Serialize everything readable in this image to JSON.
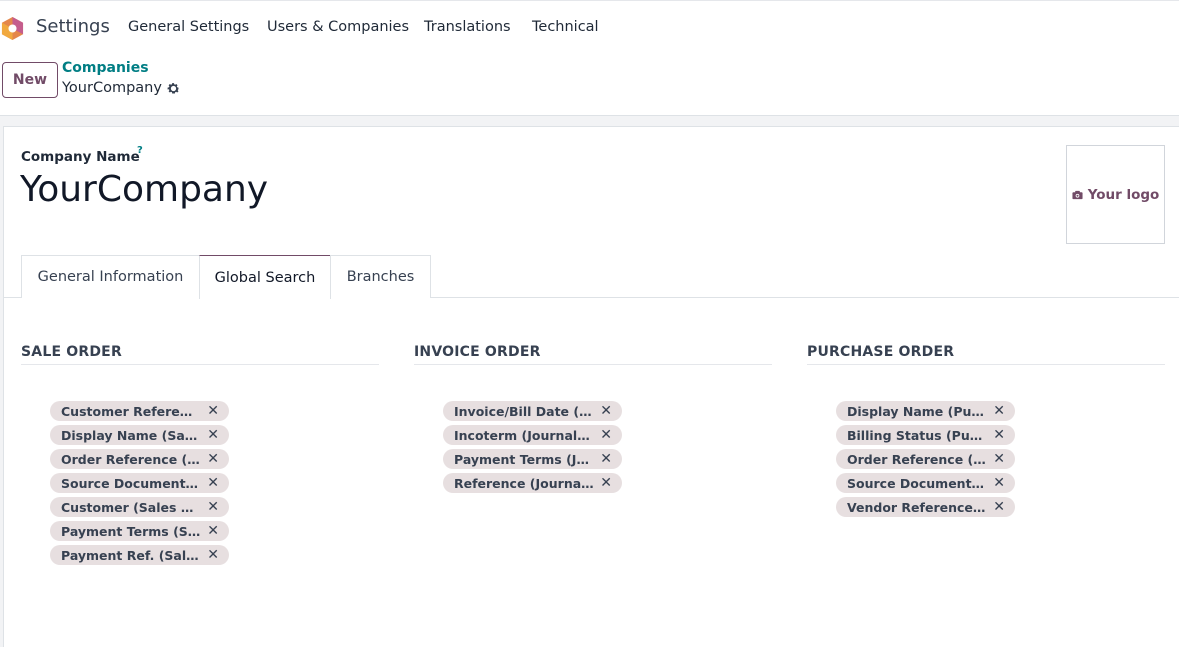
{
  "navbar": {
    "app_name": "Settings",
    "menu": [
      "General Settings",
      "Users & Companies",
      "Translations",
      "Technical"
    ]
  },
  "control": {
    "new_label": "New",
    "breadcrumb_parent": "Companies",
    "breadcrumb_current": "YourCompany"
  },
  "form": {
    "field_label": "Company Name",
    "help_mark": "?",
    "company_name": "YourCompany",
    "logo_label": "Your logo",
    "tabs": [
      "General Information",
      "Global Search",
      "Branches"
    ],
    "active_tab": "Global Search"
  },
  "sections": [
    {
      "title": "SALE ORDER",
      "tags": [
        "Customer Reference (Sales Order)",
        "Display Name (Sales Order)",
        "Order Reference (Sales Order)",
        "Source Document (Sales Order)",
        "Customer (Sales Order)",
        "Payment Terms (Sales Order)",
        "Payment Ref. (Sales Order)"
      ],
      "tags_display": [
        "Customer Reference...",
        "Display Name (Sales ...",
        "Order Reference (Sal...",
        "Source Document (S...",
        "Customer (Sales Ord...",
        "Payment Terms (Sale...",
        "Payment Ref. (Sales ..."
      ]
    },
    {
      "title": "INVOICE ORDER",
      "tags_display": [
        "Invoice/Bill Date (Jo...",
        "Incoterm (Journal En...",
        "Payment Terms (Jou...",
        "Reference (Journal E..."
      ]
    },
    {
      "title": "PURCHASE ORDER",
      "tags_display": [
        "Display Name (Purch...",
        "Billing Status (Purch...",
        "Order Reference (Pu...",
        "Source Document (P...",
        "Vendor Reference (P..."
      ]
    }
  ],
  "colors": {
    "brand": "#714b67",
    "link": "#017e84",
    "tag_bg": "#e7dfe0"
  },
  "icons": {
    "app": "odoo-settings-icon",
    "gear": "gear-icon",
    "camera": "camera-icon",
    "remove": "close-icon"
  }
}
